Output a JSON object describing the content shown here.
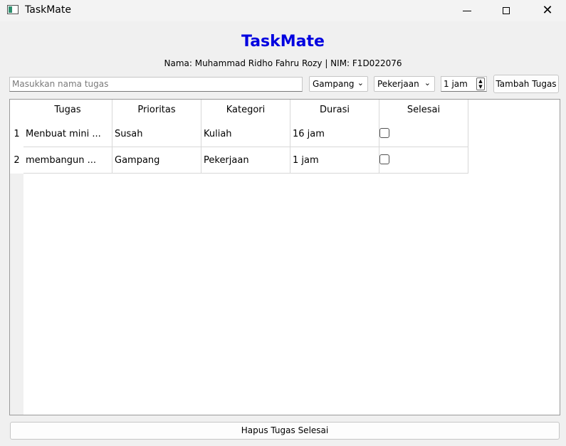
{
  "window": {
    "title": "TaskMate",
    "app_icon": "app-window-icon"
  },
  "header": {
    "title": "TaskMate",
    "subtitle": "Nama: Muhammad Ridho Fahru Rozy | NIM: F1D022076",
    "title_color": "#0000e0"
  },
  "form": {
    "task_placeholder": "Masukkan nama tugas",
    "priority_value": "Gampang",
    "category_value": "Pekerjaan",
    "duration_value": "1 jam",
    "add_label": "Tambah Tugas"
  },
  "table": {
    "headers": [
      "Tugas",
      "Prioritas",
      "Kategori",
      "Durasi",
      "Selesai"
    ],
    "rows": [
      {
        "num": "1",
        "task": "Menbuat mini ...",
        "priority": "Susah",
        "category": "Kuliah",
        "duration": "16 jam",
        "done": false
      },
      {
        "num": "2",
        "task": "membangun ...",
        "priority": "Gampang",
        "category": "Pekerjaan",
        "duration": "1 jam",
        "done": false
      }
    ]
  },
  "footer": {
    "delete_label": "Hapus Tugas Selesai"
  }
}
